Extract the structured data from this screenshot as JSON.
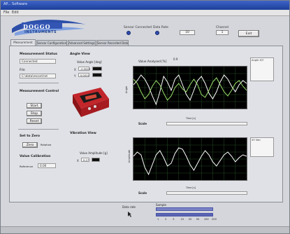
{
  "window": {
    "title": "AP... Software"
  },
  "menu": [
    "File",
    "Edit"
  ],
  "brand": {
    "line1": "DOGGO",
    "line2": "INSTRUMENTS"
  },
  "header": {
    "leds": [
      {
        "label": "Sensor Connected"
      },
      {
        "label": "Data Rate"
      }
    ],
    "channel_label": "Channel",
    "channel_value": "1",
    "rate_value": "10",
    "exit_label": "Exit"
  },
  "tabs": [
    {
      "label": "Measurement"
    },
    {
      "label": "Sensor Configuration"
    },
    {
      "label": "Advanced Settings"
    },
    {
      "label": "Sensor Recorded Data"
    }
  ],
  "left_panel": {
    "section1_title": "Measurement Status",
    "status_value": "Connected",
    "file_label": "File",
    "file_value": "C:\\data\\record.txt",
    "section2_title": "Measurement Control",
    "control_buttons": [
      "Start",
      "Stop",
      "Reset"
    ],
    "section3_title": "Set to Zero",
    "zero_button": "Zero",
    "zero_side": "Relative",
    "section4_title": "Value Calibration",
    "cal_label": "Reference",
    "cal_value": "0.00"
  },
  "angle_view": {
    "title": "Angle View",
    "indicator_label": "Value Angle [deg]",
    "x_label": "X",
    "x_value": "-0.0026",
    "y_label": "Y",
    "y_value": "0.0011"
  },
  "vibration_view": {
    "title": "Vibration View",
    "indicator_label": "Value Amplitude [g]",
    "x_label": "X",
    "x_value": "0.17"
  },
  "chart_top": {
    "title": "Value Analysed [%]",
    "value_badge": "0.9",
    "ylabel": "Angle",
    "legend_title": "Angle X/Y",
    "scale_label": "Scale",
    "scroll_label": "Time [s]"
  },
  "chart_bottom": {
    "title": "",
    "ylabel": "Amplitude",
    "legend_title": "XY Vibr",
    "scale_label": "Scale",
    "scroll_label": "Time [s]"
  },
  "bottom": {
    "indicator_label": "Data rate",
    "slider_label": "Sample",
    "ticks": [
      "1",
      "2",
      "5",
      "10",
      "20",
      "50",
      "100",
      "200"
    ]
  },
  "colors": {
    "plot_bg": "#000000",
    "series_a": "#ffffff",
    "series_b": "#9adf6a",
    "grid": "#2e5f2e"
  },
  "chart_data": [
    {
      "type": "line",
      "x": [
        0,
        1,
        2,
        3,
        4,
        5,
        6,
        7,
        8,
        9,
        10,
        11,
        12,
        13,
        14,
        15,
        16,
        17,
        18,
        19,
        20,
        21,
        22,
        23,
        24,
        25,
        26,
        27,
        28,
        29,
        30
      ],
      "series": [
        {
          "values": [
            0.2,
            0.5,
            0.9,
            0.6,
            0.1,
            -0.6,
            -1.2,
            -0.3,
            0.8,
            0.4,
            -0.2,
            0.6,
            0.9,
            0.2,
            -0.5,
            -0.9,
            -0.2,
            0.5,
            0.8,
            0.3,
            -0.4,
            -0.8,
            -0.3,
            0.4,
            0.9,
            0.6,
            0.1,
            -0.3,
            0.2,
            0.5,
            0.3
          ]
        },
        {
          "values": [
            0.6,
            0.3,
            -0.3,
            -0.8,
            -0.5,
            0.1,
            0.5,
            0.2,
            -0.4,
            -0.9,
            -0.6,
            0.0,
            0.3,
            -0.1,
            -0.3,
            0.2,
            0.6,
            0.2,
            -0.5,
            -0.7,
            -0.2,
            0.4,
            0.7,
            0.2,
            -0.3,
            -0.6,
            -0.2,
            0.3,
            0.5,
            0.1,
            -0.2
          ]
        }
      ],
      "ylim": [
        -1.5,
        1.5
      ]
    },
    {
      "type": "line",
      "x": [
        0,
        1,
        2,
        3,
        4,
        5,
        6,
        7,
        8,
        9,
        10,
        11,
        12,
        13,
        14,
        15,
        16,
        17,
        18,
        19,
        20,
        21,
        22,
        23,
        24,
        25,
        26,
        27,
        28,
        29,
        30
      ],
      "series": [
        {
          "values": [
            0.2,
            0.5,
            0.3,
            -0.6,
            -1.1,
            -0.4,
            0.3,
            0.6,
            0.1,
            -0.5,
            -0.3,
            0.4,
            0.8,
            0.7,
            0.2,
            -0.4,
            -0.8,
            -0.3,
            0.2,
            0.6,
            0.3,
            -0.2,
            -0.5,
            -0.1,
            0.3,
            0.5,
            0.2,
            -0.2,
            0.1,
            0.3,
            0.2
          ]
        }
      ],
      "ylim": [
        -1.5,
        1.5
      ]
    }
  ]
}
